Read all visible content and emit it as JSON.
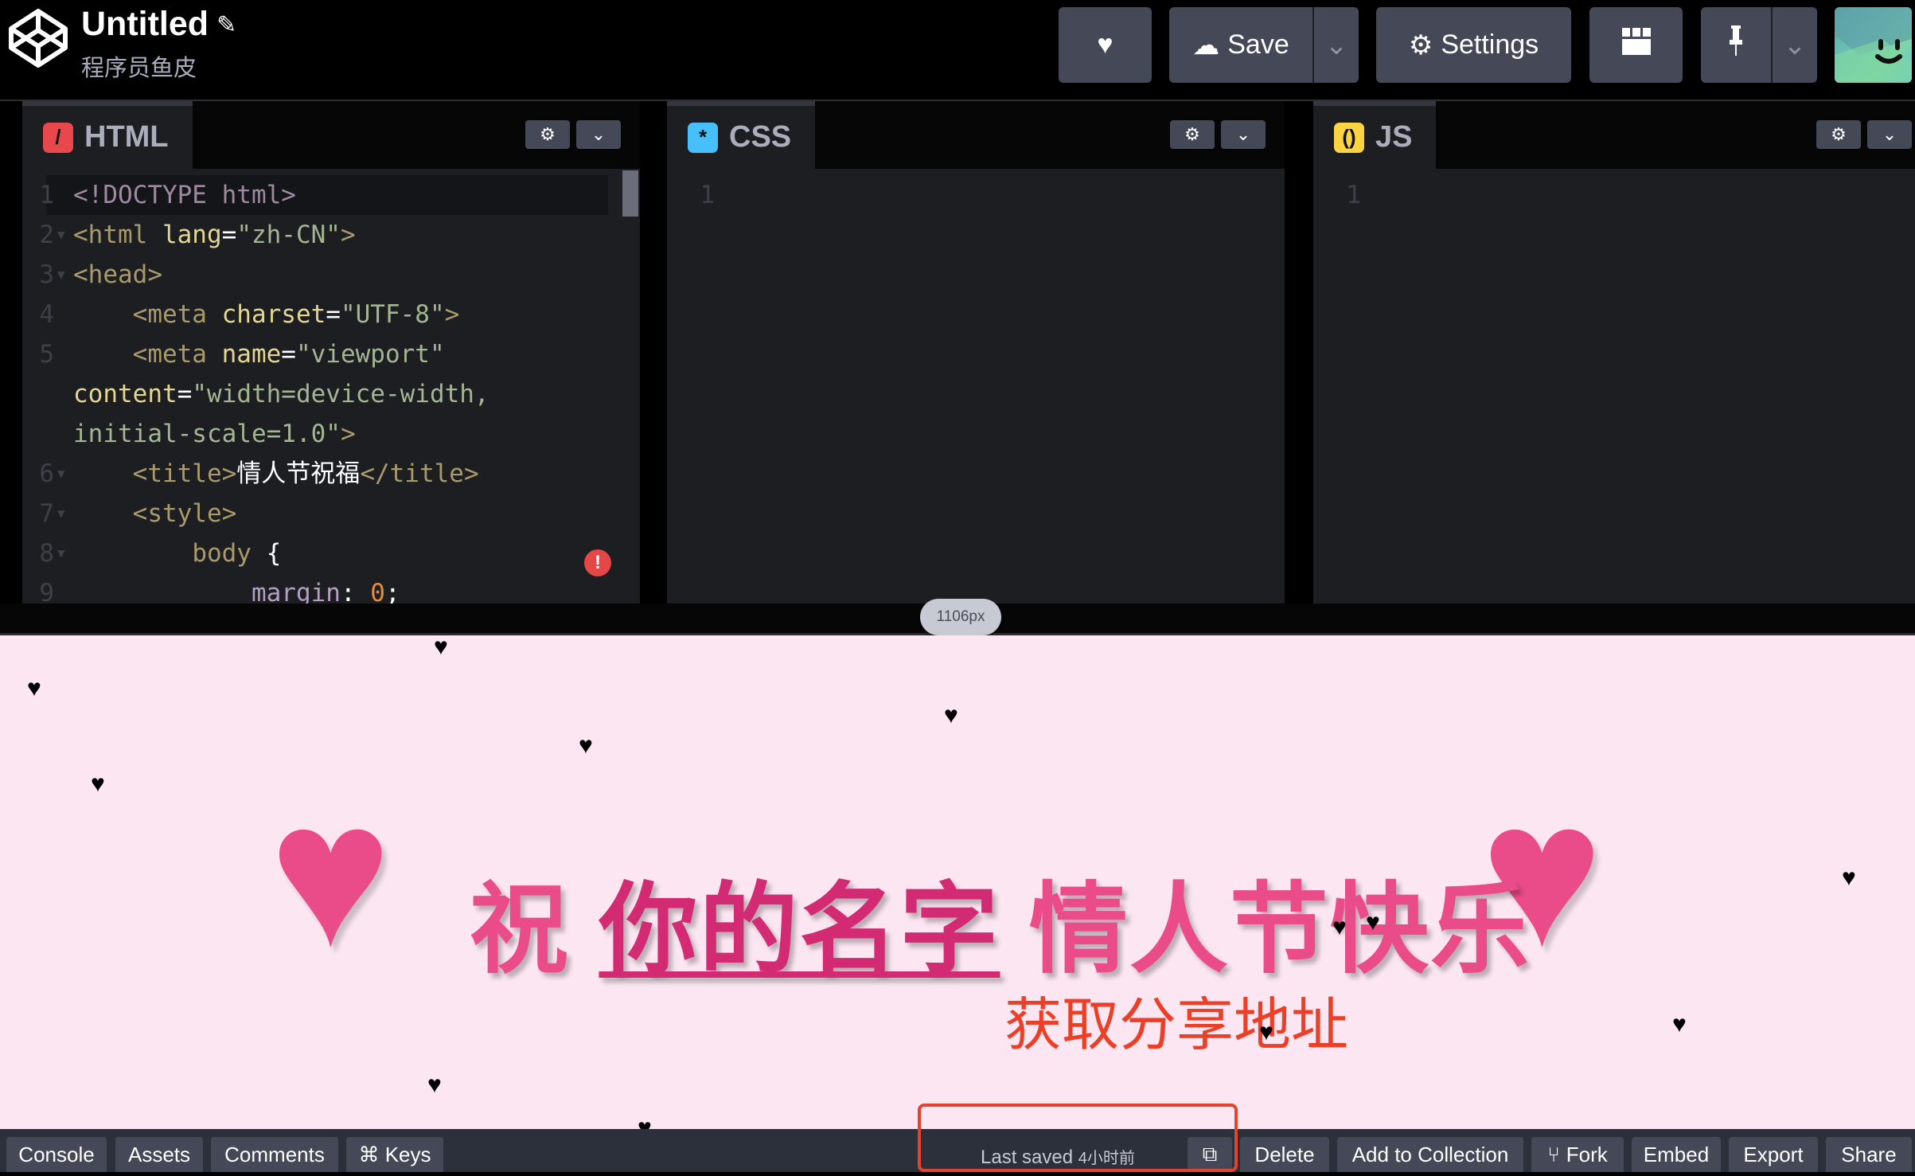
{
  "header": {
    "title": "Untitled",
    "author": "程序员鱼皮",
    "buttons": {
      "save": "Save",
      "settings": "Settings"
    }
  },
  "editors": {
    "html": {
      "label": "HTML",
      "badge_color": "#e8474b",
      "lines": [
        {
          "num": "1",
          "fold": false,
          "indent": "",
          "tokens": [
            {
              "c": "t-doc",
              "t": "<!DOCTYPE html>"
            }
          ]
        },
        {
          "num": "2",
          "fold": true,
          "indent": "",
          "tokens": [
            {
              "c": "t-tag",
              "t": "<html "
            },
            {
              "c": "t-attr",
              "t": "lang"
            },
            {
              "c": "t-white",
              "t": "="
            },
            {
              "c": "t-str",
              "t": "\"zh-CN\""
            },
            {
              "c": "t-tag",
              "t": ">"
            }
          ]
        },
        {
          "num": "3",
          "fold": true,
          "indent": "",
          "tokens": [
            {
              "c": "t-tag",
              "t": "<head>"
            }
          ]
        },
        {
          "num": "4",
          "fold": false,
          "indent": "    ",
          "tokens": [
            {
              "c": "t-tag",
              "t": "<meta "
            },
            {
              "c": "t-attr",
              "t": "charset"
            },
            {
              "c": "t-white",
              "t": "="
            },
            {
              "c": "t-str",
              "t": "\"UTF-8\""
            },
            {
              "c": "t-tag",
              "t": ">"
            }
          ]
        },
        {
          "num": "5",
          "fold": false,
          "indent": "    ",
          "tokens": [
            {
              "c": "t-tag",
              "t": "<meta "
            },
            {
              "c": "t-attr",
              "t": "name"
            },
            {
              "c": "t-white",
              "t": "="
            },
            {
              "c": "t-str",
              "t": "\"viewport\""
            }
          ]
        },
        {
          "num": "",
          "fold": false,
          "indent": "",
          "tokens": [
            {
              "c": "t-attr",
              "t": "content"
            },
            {
              "c": "t-white",
              "t": "="
            },
            {
              "c": "t-str",
              "t": "\"width=device-width,"
            }
          ]
        },
        {
          "num": "",
          "fold": false,
          "indent": "",
          "tokens": [
            {
              "c": "t-str",
              "t": "initial-scale=1.0\""
            },
            {
              "c": "t-tag",
              "t": ">"
            }
          ]
        },
        {
          "num": "6",
          "fold": true,
          "indent": "    ",
          "tokens": [
            {
              "c": "t-tag",
              "t": "<title>"
            },
            {
              "c": "t-white",
              "t": "情人节祝福"
            },
            {
              "c": "t-tag",
              "t": "</title>"
            }
          ]
        },
        {
          "num": "7",
          "fold": true,
          "indent": "    ",
          "tokens": [
            {
              "c": "t-tag",
              "t": "<style>"
            }
          ]
        },
        {
          "num": "8",
          "fold": true,
          "indent": "        ",
          "tokens": [
            {
              "c": "t-tag",
              "t": "body "
            },
            {
              "c": "t-white",
              "t": "{"
            }
          ]
        },
        {
          "num": "9",
          "fold": false,
          "indent": "            ",
          "tokens": [
            {
              "c": "t-prop",
              "t": "margin"
            },
            {
              "c": "t-white",
              "t": ": "
            },
            {
              "c": "t-num",
              "t": "0"
            },
            {
              "c": "t-white",
              "t": ";"
            }
          ]
        }
      ]
    },
    "css": {
      "label": "CSS",
      "badge_color": "#47bffa",
      "line_number": "1"
    },
    "js": {
      "label": "JS",
      "badge_color": "#fcd341",
      "line_number": "1"
    }
  },
  "resize_indicator": "1106px",
  "preview": {
    "greeting_prefix": "祝 ",
    "greeting_name": "你的名字",
    "greeting_suffix": " 情人节快乐",
    "share_link": "获取分享地址",
    "colors": {
      "heart": "#ea4c89",
      "name": "#d22b74",
      "link": "#ec3f26",
      "background": "#fbe6f1"
    }
  },
  "footer": {
    "left_buttons": [
      "Console",
      "Assets",
      "Comments",
      "⌘ Keys"
    ],
    "last_saved_label": "Last saved",
    "last_saved_ago": "4小时前",
    "right_buttons": [
      "Delete",
      "Add to Collection",
      "Fork",
      "Embed",
      "Export",
      "Share"
    ]
  }
}
